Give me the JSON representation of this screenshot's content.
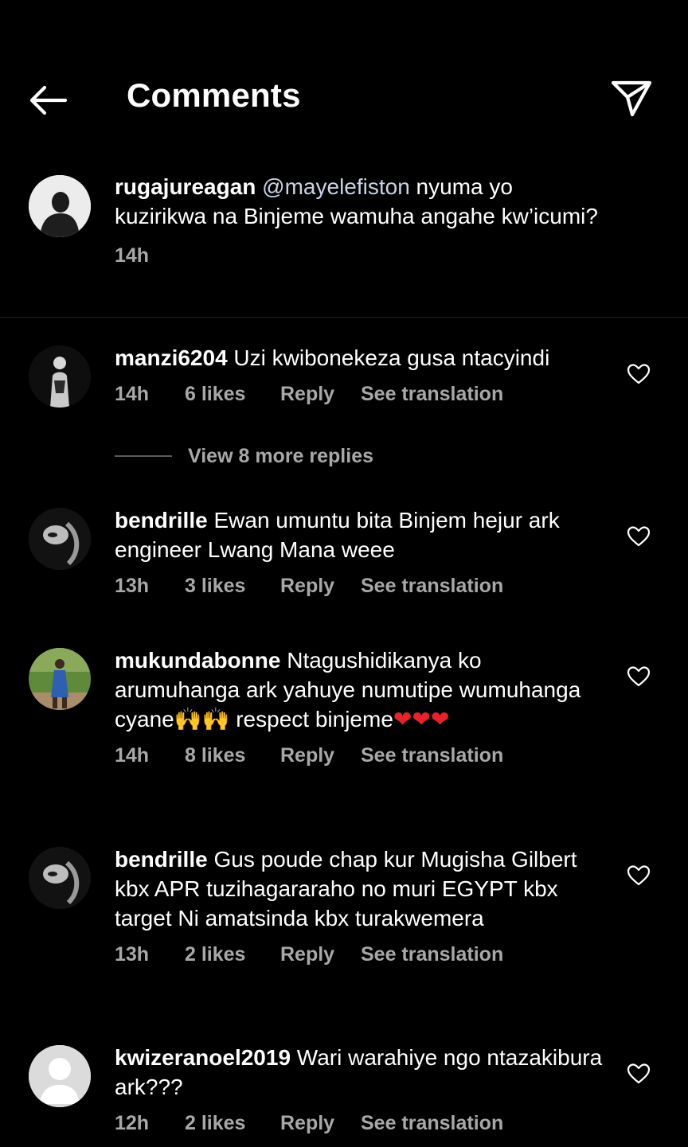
{
  "header": {
    "title": "Comments"
  },
  "caption": {
    "username": "rugajureagan",
    "mention": "@mayelefiston",
    "text": " nyuma yo kuzirikwa na Binjeme wamuha angahe kw’icumi?",
    "time": "14h"
  },
  "comments": [
    {
      "username": "manzi6204",
      "text": " Uzi kwibonekeza gusa ntacyindi",
      "time": "14h",
      "likes": "6 likes",
      "reply": "Reply",
      "translate": "See translation"
    },
    {
      "username": "bendrille",
      "text": " Ewan umuntu bita Binjem hejur ark engineer Lwang Mana weee",
      "time": "13h",
      "likes": "3 likes",
      "reply": "Reply",
      "translate": "See translation"
    },
    {
      "username": "mukundabonne",
      "text_a": " Ntagushidikanya ko arumuhanga ark yahuye numutipe wumuhanga cyane",
      "emoji_a": "🙌🙌",
      "text_b": " respect binjeme",
      "emoji_b": "❤❤❤",
      "time": "14h",
      "likes": "8 likes",
      "reply": "Reply",
      "translate": "See translation"
    },
    {
      "username": "bendrille",
      "text": " Gus poude chap kur Mugisha Gilbert kbx APR tuzihagararaho no muri EGYPT kbx target Ni amatsinda kbx turakwemera",
      "time": "13h",
      "likes": "2 likes",
      "reply": "Reply",
      "translate": "See translation"
    },
    {
      "username": "kwizeranoel2019",
      "text": " Wari warahiye ngo ntazakibura ark???",
      "time": "12h",
      "likes": "2 likes",
      "reply": "Reply",
      "translate": "See translation"
    }
  ],
  "view_more_replies": "View 8 more replies"
}
